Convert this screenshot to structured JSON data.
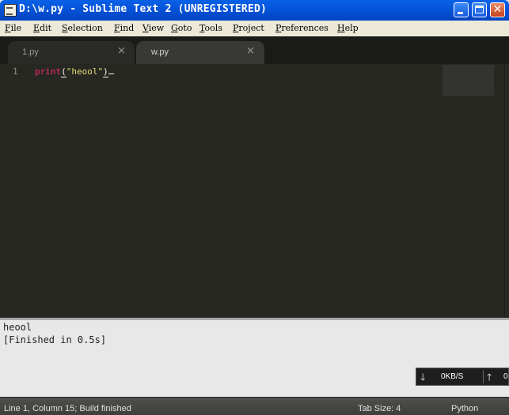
{
  "window": {
    "title": "D:\\w.py - Sublime Text 2 (UNREGISTERED)",
    "icon": "sublime-app-icon",
    "close_glyph": "✕"
  },
  "menu": {
    "items": [
      {
        "label": "File"
      },
      {
        "label": "Edit"
      },
      {
        "label": "Selection"
      },
      {
        "label": "Find"
      },
      {
        "label": "View"
      },
      {
        "label": "Goto"
      },
      {
        "label": "Tools"
      },
      {
        "label": "Project"
      },
      {
        "label": "Preferences"
      },
      {
        "label": "Help"
      }
    ]
  },
  "tabs": [
    {
      "label": "1.py",
      "active": false,
      "close": "×"
    },
    {
      "label": "w.py",
      "active": true,
      "close": "×"
    }
  ],
  "editor": {
    "line_number": "1",
    "code": {
      "keyword": "print",
      "open_paren": "(",
      "string": "\"heool\"",
      "close_paren": ")"
    }
  },
  "output": {
    "lines": [
      "heool",
      "[Finished in 0.5s]"
    ]
  },
  "network_widget": {
    "down_icon": "🡓",
    "down_speed": "0KB/S",
    "up_icon": "🡑",
    "up_speed": "0"
  },
  "status": {
    "left": "Line 1, Column 15; Build finished",
    "tab_size": "Tab Size: 4",
    "syntax": "Python"
  },
  "colors": {
    "editor_bg": "#272822",
    "keyword": "#f92672",
    "string": "#e6db74",
    "titlebar": "#0553d8"
  }
}
